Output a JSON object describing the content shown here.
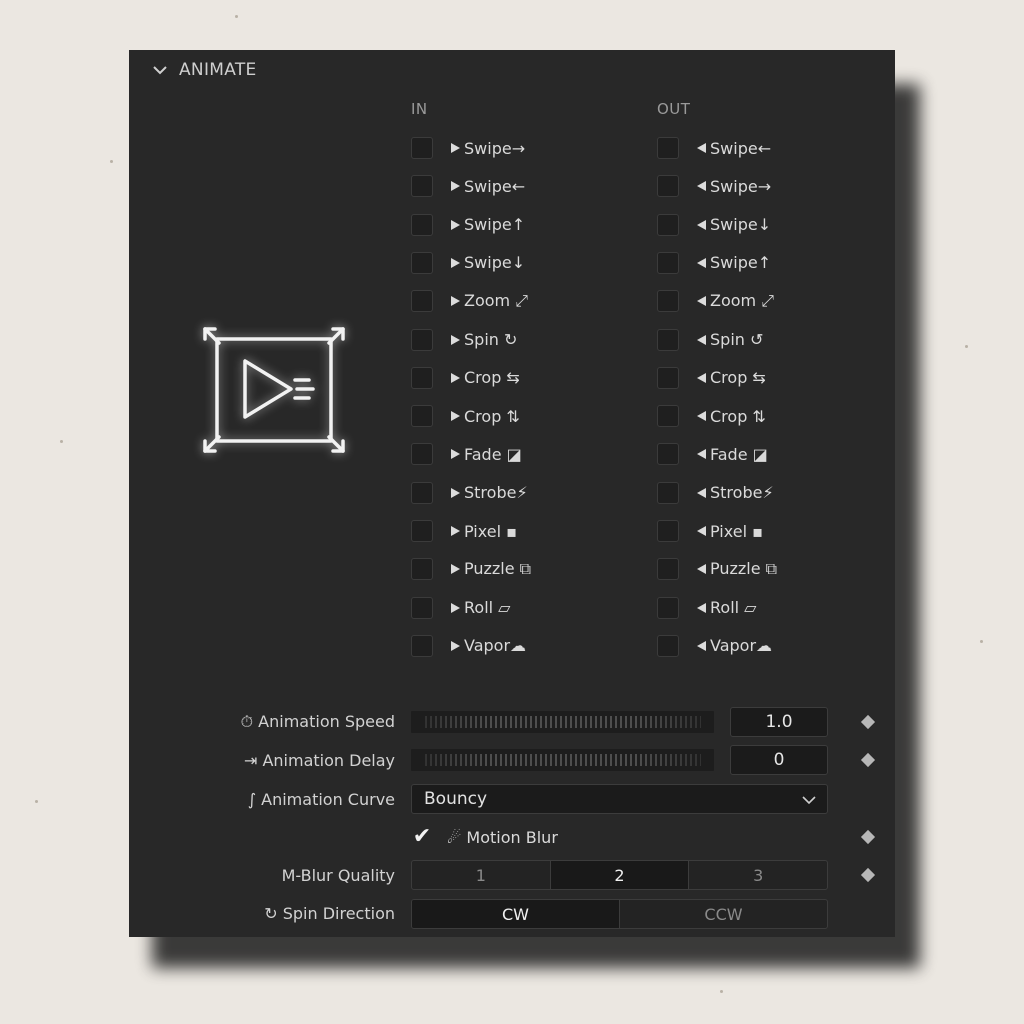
{
  "panel": {
    "title": "ANIMATE"
  },
  "columns": {
    "in": "IN",
    "out": "OUT"
  },
  "in_options": [
    "Swipe→",
    "Swipe←",
    "Swipe↑",
    "Swipe↓",
    "Zoom ⤢",
    "Spin ↻",
    "Crop ⇆",
    "Crop ⇅",
    "Fade ◪",
    "Strobe⚡",
    "Pixel ▪",
    "Puzzle ⧉",
    "Roll ▱",
    "Vapor☁"
  ],
  "out_options": [
    "Swipe←",
    "Swipe→",
    "Swipe↓",
    "Swipe↑",
    "Zoom ⤢",
    "Spin ↺",
    "Crop ⇆",
    "Crop ⇅",
    "Fade ◪",
    "Strobe⚡",
    "Pixel ▪",
    "Puzzle ⧉",
    "Roll ▱",
    "Vapor☁"
  ],
  "params": {
    "speed_label": "⏱ Animation Speed",
    "speed_value": "1.0",
    "delay_label": "⇥ Animation Delay",
    "delay_value": "0",
    "curve_label": "∫ Animation Curve",
    "curve_value": "Bouncy",
    "motion_blur_label": "☄ Motion Blur",
    "motion_blur_checked": true,
    "quality_label": "M-Blur Quality",
    "quality_options": [
      "1",
      "2",
      "3"
    ],
    "quality_selected": "2",
    "spin_label": "↻ Spin Direction",
    "spin_options": [
      "CW",
      "CCW"
    ],
    "spin_selected": "CW"
  },
  "colors": {
    "panel": "#282828",
    "background": "#ebe7e1",
    "text": "#d2d2d2"
  }
}
